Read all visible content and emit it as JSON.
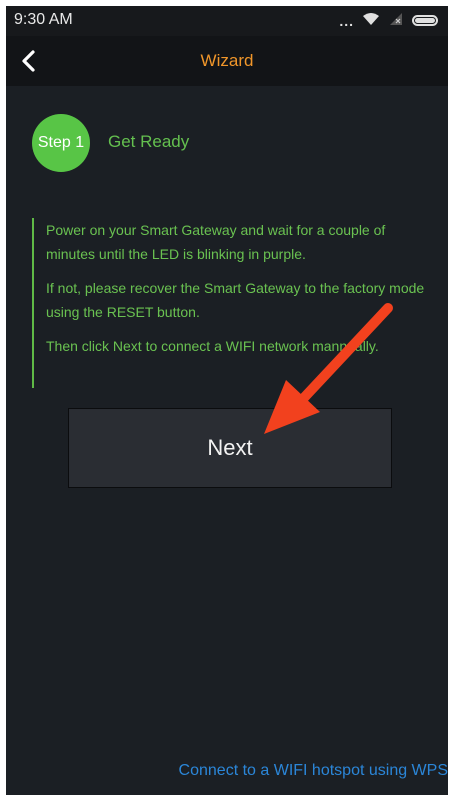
{
  "status_bar": {
    "time": "9:30 AM",
    "signal_dots": "...",
    "icons": [
      "wifi-icon",
      "no-signal-icon",
      "battery-icon"
    ]
  },
  "header": {
    "title": "Wizard",
    "back_icon": "chevron-left-icon"
  },
  "step": {
    "badge": "Step 1",
    "title": "Get Ready"
  },
  "instructions": [
    "Power on your Smart Gateway and wait for a couple of minutes until the LED is blinking in purple.",
    "If not, please recover the Smart Gateway to the factory mode using the RESET button.",
    "Then click Next to connect a WIFI network mannually."
  ],
  "actions": {
    "next_label": "Next",
    "wps_link": "Connect to a WIFI hotspot using WPS"
  },
  "colors": {
    "accent_orange": "#f0962a",
    "green": "#58c546",
    "text_green": "#6ac251",
    "link_blue": "#2b86d8",
    "arrow_red": "#f2411e",
    "background": "#1b1f24"
  }
}
